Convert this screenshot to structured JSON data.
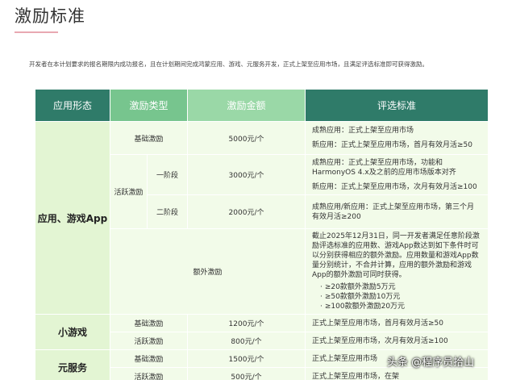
{
  "page_title": "激励标准",
  "intro": "开发者在本计划要求的报名期限内成功报名，且在计划期间完成鸿蒙应用、游戏、元服务开发，正式上架至应用市场，且满足评选标准即可获得激励。",
  "table": {
    "headers": [
      "应用形态",
      "激励类型",
      "激励金额",
      "评选标准"
    ],
    "app_game": {
      "form": "应用、游戏App",
      "basic": {
        "type": "基础激励",
        "amount": "5000元/个",
        "criteria": [
          "成熟应用：正式上架至应用市场",
          "新应用：正式上架至应用市场，首月有效月活≥50"
        ]
      },
      "active": {
        "type": "活跃激励",
        "stage1": {
          "label": "一阶段",
          "amount": "3000元/个",
          "criteria": [
            "成熟应用：正式上架至应用市场，功能和HarmonyOS 4.x及之前的应用市场版本对齐",
            "新应用：正式上架至应用市场，次月有效月活≥100"
          ]
        },
        "stage2": {
          "label": "二阶段",
          "amount": "2000元/个",
          "criteria": [
            "成熟应用/新应用：正式上架至应用市场，第三个月有效月活≥200"
          ]
        }
      },
      "extra": {
        "type": "额外激励",
        "desc": [
          "截止2025年12月31日，同一开发者满足任意阶段激励评选标准的应用数、游戏App数达到如下条件时可以分别获得相应的额外激励。应用数量和游戏App数量分别统计，不合并计算，应用的额外激励和游戏App的额外激励可同时获得。"
        ],
        "bullets": [
          "≥20款额外激励5万元",
          "≥50款额外激励10万元",
          "≥100款额外激励20万元"
        ]
      }
    },
    "mini_game": {
      "form": "小游戏",
      "basic": {
        "type": "基础激励",
        "amount": "1200元/个",
        "criteria": "正式上架至应用市场，首月有效月活≥50"
      },
      "active": {
        "type": "活跃激励",
        "amount": "800元/个",
        "criteria": "正式上架至应用市场，次月有效月活≥100"
      }
    },
    "atomic": {
      "form": "元服务",
      "basic": {
        "type": "基础激励",
        "amount": "1500元/个",
        "criteria": "正式上架至应用市场"
      },
      "active": {
        "type": "活跃激励",
        "amount": "500元/个",
        "criteria": "正式上架至应用市场，在架"
      }
    }
  },
  "watermark": "头条 @程序员拾山"
}
